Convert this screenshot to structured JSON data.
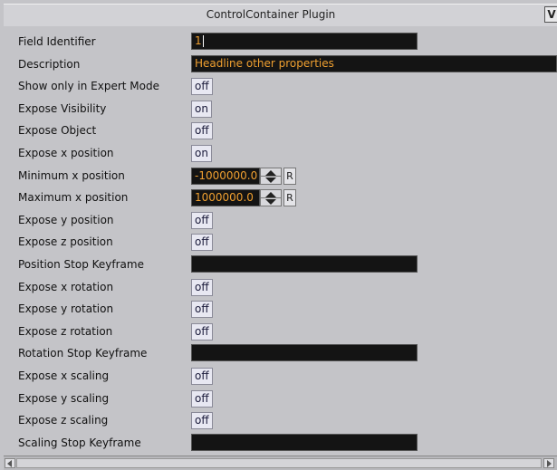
{
  "window": {
    "title": "ControlContainer Plugin",
    "corner_icon": "plugin-logo-icon",
    "corner_glyph": "V"
  },
  "colors": {
    "background": "#c4c4c8",
    "field_bg": "#141414",
    "field_text": "#f0a030",
    "toggle_bg": "#e8e8f2"
  },
  "rows": [
    {
      "label": "Field Identifier",
      "type": "text",
      "value": "1"
    },
    {
      "label": "Description",
      "type": "text-wide",
      "value": "Headline other properties"
    },
    {
      "label": "Show only in Expert Mode",
      "type": "toggle",
      "value": "off"
    },
    {
      "label": "Expose Visibility",
      "type": "toggle",
      "value": "on"
    },
    {
      "label": "Expose Object",
      "type": "toggle",
      "value": "off"
    },
    {
      "label": "Expose x position",
      "type": "toggle",
      "value": "on"
    },
    {
      "label": "Minimum x position",
      "type": "number",
      "value": "-1000000.0",
      "reset": "R"
    },
    {
      "label": "Maximum x position",
      "type": "number",
      "value": "1000000.0",
      "reset": "R"
    },
    {
      "label": "Expose y position",
      "type": "toggle",
      "value": "off"
    },
    {
      "label": "Expose z position",
      "type": "toggle",
      "value": "off"
    },
    {
      "label": "Position Stop Keyframe",
      "type": "text",
      "value": ""
    },
    {
      "label": "Expose x rotation",
      "type": "toggle",
      "value": "off"
    },
    {
      "label": "Expose y rotation",
      "type": "toggle",
      "value": "off"
    },
    {
      "label": "Expose z rotation",
      "type": "toggle",
      "value": "off"
    },
    {
      "label": "Rotation Stop Keyframe",
      "type": "text",
      "value": ""
    },
    {
      "label": "Expose x scaling",
      "type": "toggle",
      "value": "off"
    },
    {
      "label": "Expose y scaling",
      "type": "toggle",
      "value": "off"
    },
    {
      "label": "Expose z scaling",
      "type": "toggle",
      "value": "off"
    },
    {
      "label": "Scaling Stop Keyframe",
      "type": "text",
      "value": ""
    }
  ],
  "scrollbar": {
    "left_icon": "scroll-left-arrow-icon",
    "right_icon": "scroll-right-arrow-icon"
  }
}
